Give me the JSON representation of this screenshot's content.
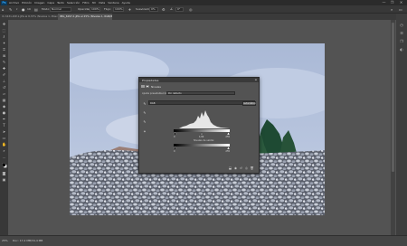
{
  "app": {
    "logo": "Ps",
    "menu": [
      "Archivo",
      "Edición",
      "Imagen",
      "Capa",
      "Texto",
      "Selección",
      "Filtro",
      "3D",
      "Vista",
      "Ventana",
      "Ayuda"
    ],
    "window_controls": [
      "—",
      "❐",
      "✕"
    ]
  },
  "options_bar": {
    "tool_icon": "eyedropper-icon",
    "brush_size": "19",
    "mode_label": "Modo:",
    "mode_value": "Normal",
    "opacity_label": "Opacidad:",
    "opacity_value": "100%",
    "flow_label": "Flujo:",
    "flow_value": "100%",
    "smoothing_label": "Suavizado:",
    "smoothing_value": "0%",
    "angle_value": "0°"
  },
  "tabs": [
    {
      "label": "IC-3431-DIP-1.JPG al 8,33% (Niveles 1, Máscara de capa/8)",
      "active": false
    },
    {
      "label": "IMG_6297-1.JPG al 25% (Niveles 1, RGB/8) *",
      "active": true
    }
  ],
  "toolbar": {
    "tools": [
      "move-icon",
      "marquee-icon",
      "lasso-icon",
      "quick-select-icon",
      "crop-icon",
      "frame-icon",
      "eyedropper-icon",
      "healing-icon",
      "brush-icon",
      "stamp-icon",
      "history-brush-icon",
      "eraser-icon",
      "gradient-icon",
      "blur-icon",
      "dodge-icon",
      "pen-icon",
      "type-icon",
      "path-select-icon",
      "shape-icon",
      "hand-icon",
      "zoom-icon",
      "more-icon"
    ]
  },
  "status": {
    "zoom": "25%",
    "doc": "Doc: 17,2 MB/34,4 MB"
  },
  "properties": {
    "title": "Propiedades",
    "menu_icon": "≡",
    "adjustment_label": "Niveles",
    "preset_label": "Ajuste preestablecido:",
    "preset_value": "Por defecto",
    "channel_value": "RGB",
    "auto_label": "Automático",
    "input_values": [
      "0",
      "1,00",
      "255"
    ],
    "output_label": "Niveles de salida:",
    "output_values": [
      "0",
      "255"
    ]
  },
  "colors": {
    "accent": "#31a8ff",
    "panel": "#535353",
    "dark": "#2b2b2b"
  }
}
